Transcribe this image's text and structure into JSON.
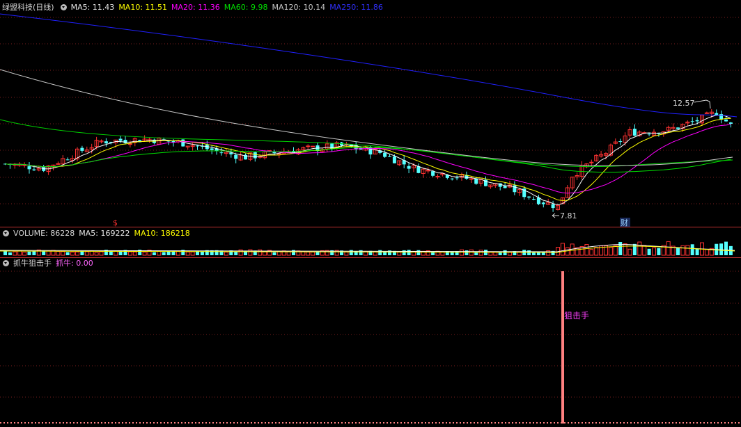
{
  "main_header": {
    "title": "绿盟科技(日线)",
    "ma5": "MA5: 11.43",
    "ma10": "MA10: 11.51",
    "ma20": "MA20: 11.36",
    "ma60": "MA60: 9.98",
    "ma120": "MA120: 10.14",
    "ma250": "MA250: 11.86"
  },
  "volume_header": {
    "label": "VOLUME: 86228",
    "ma5": "MA5: 169222",
    "ma10": "MA10: 186218"
  },
  "indicator_header": {
    "title": "抓牛狙击手",
    "value": "抓牛: 0.00"
  },
  "annotations": {
    "high": "12.57",
    "low": "7.81",
    "event_financial": "财",
    "event_dividend": "$",
    "signal": "狙击手"
  },
  "colors": {
    "up": "#ff3232",
    "down": "#54ffff",
    "ma5": "#ffffff",
    "ma10": "#ffff00",
    "ma20": "#ff00ff",
    "ma60": "#00e000",
    "ma120": "#c8c8c8",
    "ma250": "#2020ff",
    "signal_bar": "#ff8080"
  },
  "chart_data": [
    {
      "type": "candlestick",
      "title": "绿盟科技(日线)",
      "ylim": [
        7.3,
        13.8
      ],
      "series_names": [
        "MA5",
        "MA10",
        "MA20",
        "MA60",
        "MA120",
        "MA250"
      ],
      "last_values": [
        11.43,
        11.51,
        11.36,
        9.98,
        10.14,
        11.86
      ],
      "annotations": [
        {
          "label": "12.57",
          "value": 12.57
        },
        {
          "label": "7.81",
          "value": 7.81
        }
      ]
    },
    {
      "type": "bar",
      "title": "VOLUME",
      "series_names": [
        "VOLUME",
        "MA5",
        "MA10"
      ],
      "last_values": [
        86228,
        169222,
        186218
      ]
    },
    {
      "type": "bar",
      "title": "抓牛狙击手",
      "series_names": [
        "抓牛"
      ],
      "last_values": [
        0.0
      ],
      "signals": [
        {
          "label": "狙击手"
        }
      ]
    }
  ]
}
